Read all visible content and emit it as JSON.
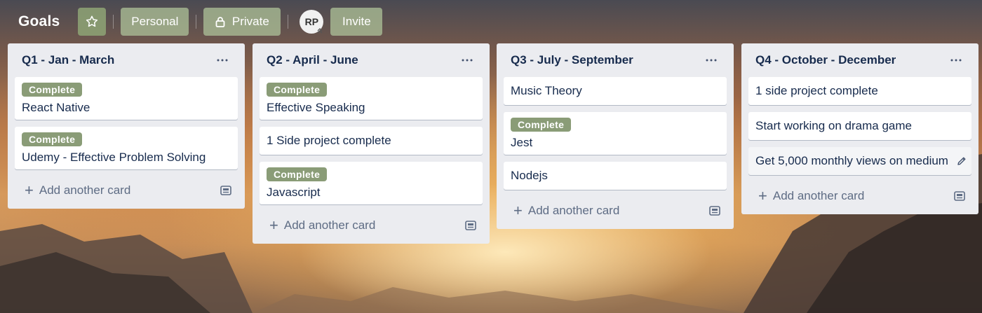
{
  "board": {
    "title": "Goals",
    "star_icon": "star-icon",
    "visibility_team": "Personal",
    "visibility_privacy": "Private",
    "lock_icon": "lock-icon",
    "member_initials": "RP",
    "invite_label": "Invite"
  },
  "lists": [
    {
      "title": "Q1 - Jan - March",
      "cards": [
        {
          "label": "Complete",
          "title": "React Native"
        },
        {
          "label": "Complete",
          "title": "Udemy - Effective Problem Solving"
        }
      ],
      "add_label": "Add another card"
    },
    {
      "title": "Q2 - April - June",
      "cards": [
        {
          "label": "Complete",
          "title": "Effective Speaking"
        },
        {
          "label": "",
          "title": "1 Side project complete"
        },
        {
          "label": "Complete",
          "title": "Javascript"
        }
      ],
      "add_label": "Add another card"
    },
    {
      "title": "Q3 - July - September",
      "cards": [
        {
          "label": "",
          "title": "Music Theory"
        },
        {
          "label": "Complete",
          "title": "Jest"
        },
        {
          "label": "",
          "title": "Nodejs"
        }
      ],
      "add_label": "Add another card"
    },
    {
      "title": "Q4 - October - December",
      "cards": [
        {
          "label": "",
          "title": "1 side project complete"
        },
        {
          "label": "",
          "title": "Start working on drama game"
        },
        {
          "label": "",
          "title": "Get 5,000 monthly views on medium"
        }
      ],
      "add_label": "Add another card"
    }
  ],
  "colors": {
    "label_green": "#8a9c77",
    "list_bg": "#ebecf0",
    "header_button": "#aabe96"
  }
}
